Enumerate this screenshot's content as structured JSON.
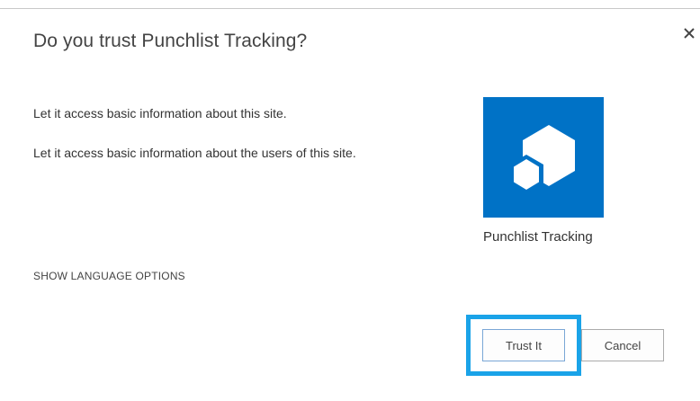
{
  "dialog": {
    "title": "Do you trust Punchlist Tracking?",
    "close_icon": "close-icon"
  },
  "permissions": [
    "Let it access basic information about this site.",
    "Let it access basic information about the users of this site."
  ],
  "app": {
    "name": "Punchlist Tracking",
    "icon": "app-hexagon-icon",
    "tile_color": "#0072c6"
  },
  "language_link": "SHOW LANGUAGE OPTIONS",
  "buttons": {
    "trust": "Trust It",
    "cancel": "Cancel"
  },
  "highlight_color": "#1aa3e8"
}
